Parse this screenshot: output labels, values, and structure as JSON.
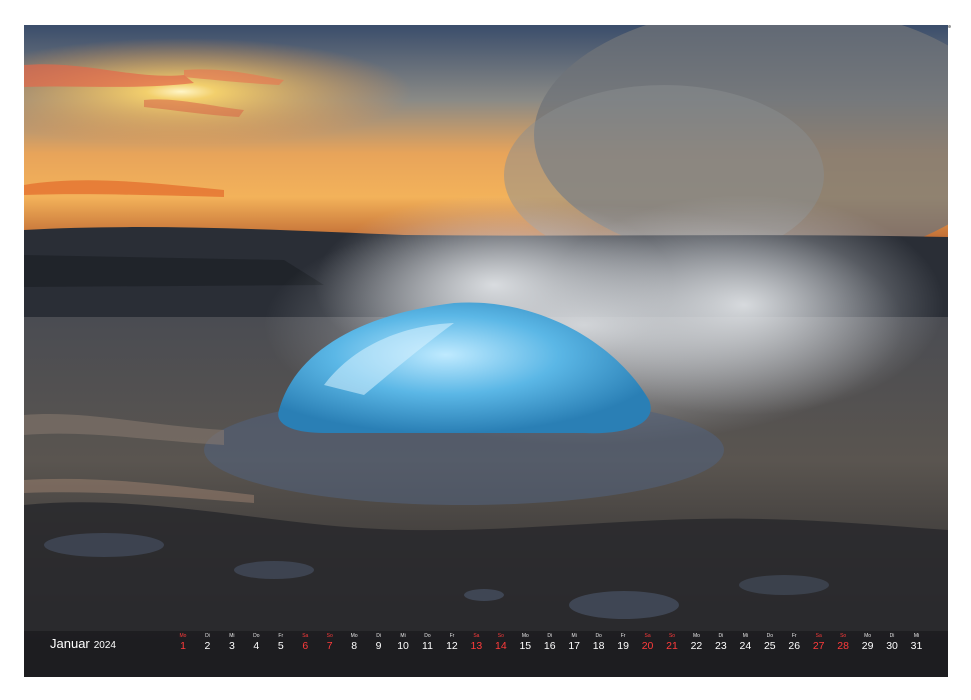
{
  "calendar": {
    "month": "Januar",
    "year": "2024",
    "days": [
      {
        "wd": "Mo",
        "d": "1",
        "type": "sun"
      },
      {
        "wd": "Di",
        "d": "2",
        "type": ""
      },
      {
        "wd": "Mi",
        "d": "3",
        "type": ""
      },
      {
        "wd": "Do",
        "d": "4",
        "type": ""
      },
      {
        "wd": "Fr",
        "d": "5",
        "type": ""
      },
      {
        "wd": "Sa",
        "d": "6",
        "type": "sat"
      },
      {
        "wd": "So",
        "d": "7",
        "type": "sun"
      },
      {
        "wd": "Mo",
        "d": "8",
        "type": ""
      },
      {
        "wd": "Di",
        "d": "9",
        "type": ""
      },
      {
        "wd": "Mi",
        "d": "10",
        "type": ""
      },
      {
        "wd": "Do",
        "d": "11",
        "type": ""
      },
      {
        "wd": "Fr",
        "d": "12",
        "type": ""
      },
      {
        "wd": "Sa",
        "d": "13",
        "type": "sat"
      },
      {
        "wd": "So",
        "d": "14",
        "type": "sun"
      },
      {
        "wd": "Mo",
        "d": "15",
        "type": ""
      },
      {
        "wd": "Di",
        "d": "16",
        "type": ""
      },
      {
        "wd": "Mi",
        "d": "17",
        "type": ""
      },
      {
        "wd": "Do",
        "d": "18",
        "type": ""
      },
      {
        "wd": "Fr",
        "d": "19",
        "type": ""
      },
      {
        "wd": "Sa",
        "d": "20",
        "type": "sat"
      },
      {
        "wd": "So",
        "d": "21",
        "type": "sun"
      },
      {
        "wd": "Mo",
        "d": "22",
        "type": ""
      },
      {
        "wd": "Di",
        "d": "23",
        "type": ""
      },
      {
        "wd": "Mi",
        "d": "24",
        "type": ""
      },
      {
        "wd": "Do",
        "d": "25",
        "type": ""
      },
      {
        "wd": "Fr",
        "d": "26",
        "type": ""
      },
      {
        "wd": "Sa",
        "d": "27",
        "type": "sat"
      },
      {
        "wd": "So",
        "d": "28",
        "type": "sun"
      },
      {
        "wd": "Mo",
        "d": "29",
        "type": ""
      },
      {
        "wd": "Di",
        "d": "30",
        "type": ""
      },
      {
        "wd": "Mi",
        "d": "31",
        "type": ""
      }
    ]
  },
  "colors": {
    "weekend": "#ff3b3b",
    "weekday": "#ffffff"
  }
}
